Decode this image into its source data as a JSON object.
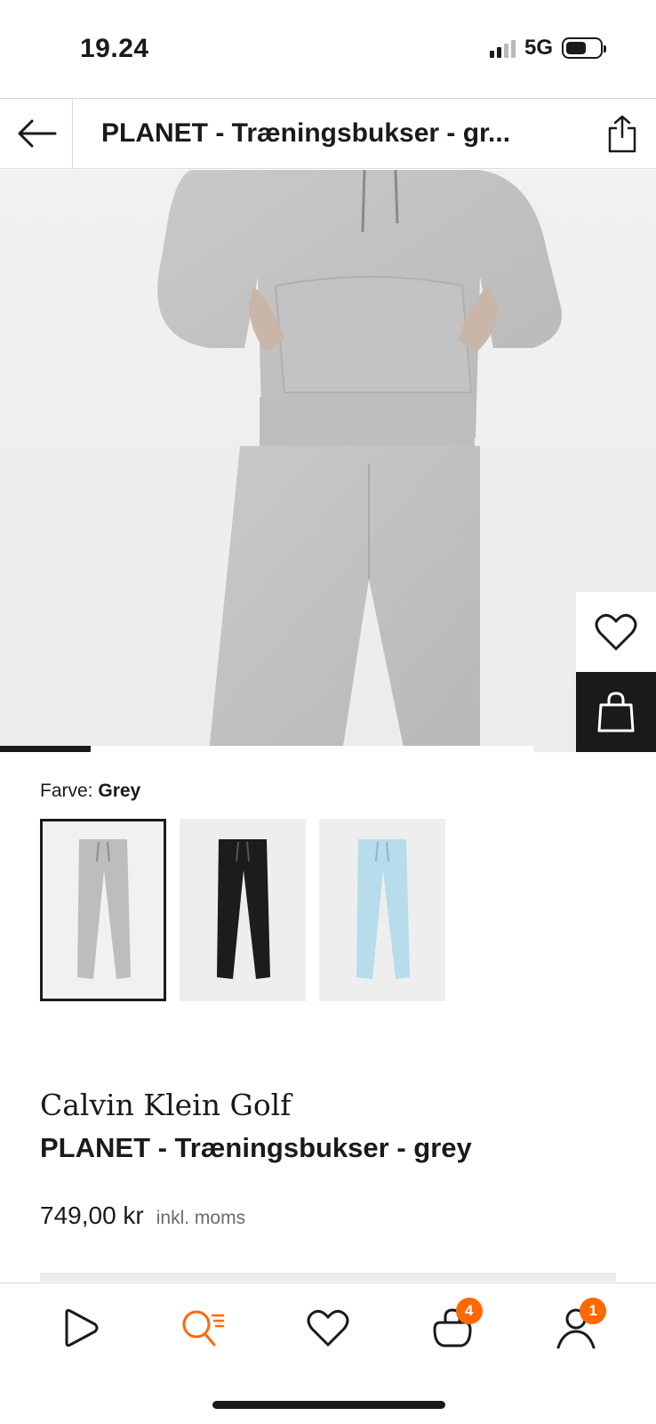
{
  "status_bar": {
    "time": "19.24",
    "network": "5G",
    "battery_level": 0.6
  },
  "header": {
    "title": "PLANET - Træningsbukser - gr...",
    "back_icon": "arrow-left-icon",
    "share_icon": "share-icon"
  },
  "hero": {
    "image_description_icon": "product-photo",
    "gallery_progress": 0.17,
    "wishlist_icon": "heart-icon",
    "bag_icon": "shopping-bag-icon"
  },
  "color": {
    "label": "Farve:",
    "selected": "Grey",
    "swatches": [
      {
        "color": "#bdbdbd",
        "selected": true
      },
      {
        "color": "#1c1c1c",
        "selected": false
      },
      {
        "color": "#b7dcec",
        "selected": false
      }
    ]
  },
  "product": {
    "brand": "Calvin Klein Golf",
    "name": "PLANET - Træningsbukser - grey",
    "price": "749,00 kr",
    "vat": "inkl. moms"
  },
  "bottom_nav": {
    "items": [
      {
        "icon": "home-play-icon"
      },
      {
        "icon": "search-icon",
        "active": true
      },
      {
        "icon": "heart-icon"
      },
      {
        "icon": "bag-icon",
        "badge": "4"
      },
      {
        "icon": "profile-icon",
        "badge": "1"
      }
    ],
    "accent": "#ff6900"
  }
}
